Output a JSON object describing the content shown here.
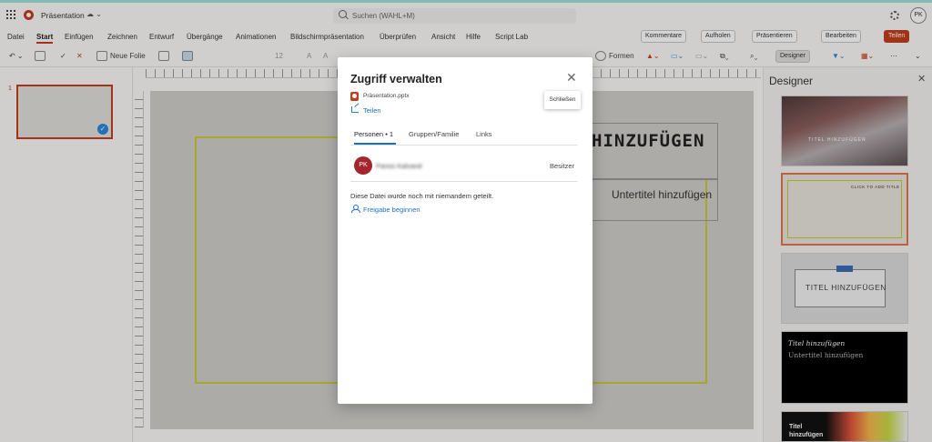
{
  "app": {
    "doc_title": "Präsentation",
    "search_placeholder": "Suchen (WAHL+M)",
    "user_initials": "PK"
  },
  "menu": [
    "Datei",
    "Start",
    "Einfügen",
    "Zeichnen",
    "Entwurf",
    "Übergänge",
    "Animationen",
    "Bildschirmpräsentation",
    "Überprüfen",
    "Ansicht",
    "Hilfe",
    "Script Lab"
  ],
  "ribbon_right": {
    "comments": "Kommentare",
    "catchup": "Aufholen",
    "present": "Präsentieren",
    "edit": "Bearbeiten",
    "share": "Teilen"
  },
  "toolbar": {
    "new_slide": "Neue Folie",
    "font_size": "12",
    "shapes": "Formen",
    "designer": "Designer"
  },
  "thumbnails": {
    "slide_number": "1"
  },
  "slide": {
    "title_placeholder": "HINZUFÜGEN",
    "subtitle_placeholder": "Untertitel hinzufügen"
  },
  "designer": {
    "title": "Designer",
    "d1_text": "TITEL HINZUFÜGEN",
    "d2_text": "CLICK TO ADD TITLE",
    "d3_text": "TITEL HINZUFÜGEN",
    "d4_title": "Titel hinzufügen",
    "d4_subtitle": "Untertitel hinzufügen",
    "d5_text": "Titel hinzufügen"
  },
  "dialog": {
    "title": "Zugriff verwalten",
    "close_tooltip": "Schließen",
    "file_name": "Präsentation.pptx",
    "share_link": "Teilen",
    "tabs": [
      "Personen • 1",
      "Gruppen/Familie",
      "Links"
    ],
    "person_initials": "PK",
    "person_name": "Panos Kalvand",
    "person_role": "Besitzer",
    "message": "Diese Datei wurde noch mit niemandem geteilt.",
    "start_sharing": "Freigabe beginnen"
  },
  "colors": {
    "accent": "#c43e1c",
    "link": "#1f6fc5"
  }
}
